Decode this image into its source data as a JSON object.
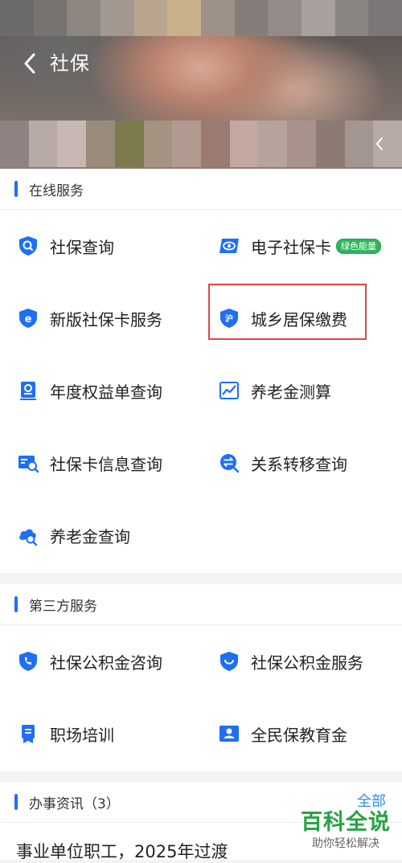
{
  "header": {
    "title": "社保"
  },
  "sections": {
    "online": {
      "title": "在线服务",
      "items": [
        {
          "label": "社保查询",
          "icon": "shield-search-icon"
        },
        {
          "label": "电子社保卡",
          "icon": "eye-card-icon",
          "badge": "绿色能量"
        },
        {
          "label": "新版社保卡服务",
          "icon": "shield-e-icon"
        },
        {
          "label": "城乡居保缴费",
          "icon": "shield-hu-icon"
        },
        {
          "label": "年度权益单查询",
          "icon": "receipt-search-icon"
        },
        {
          "label": "养老金测算",
          "icon": "line-chart-icon"
        },
        {
          "label": "社保卡信息查询",
          "icon": "card-search-icon"
        },
        {
          "label": "关系转移查询",
          "icon": "transfer-search-icon"
        },
        {
          "label": "养老金查询",
          "icon": "cloud-search-icon"
        }
      ]
    },
    "third": {
      "title": "第三方服务",
      "items": [
        {
          "label": "社保公积金咨询",
          "icon": "shield-phone-icon"
        },
        {
          "label": "社保公积金服务",
          "icon": "shield-smile-icon"
        },
        {
          "label": "职场培训",
          "icon": "ribbon-badge-icon"
        },
        {
          "label": "全民保教育金",
          "icon": "person-card-icon"
        }
      ]
    },
    "news": {
      "title": "办事资讯（3）",
      "more": "全部",
      "first_item": "事业单位职工，2025年过渡"
    }
  },
  "watermark": {
    "brand": "百科全说",
    "slogan": "助你轻松解决"
  },
  "colors": {
    "accent": "#1e6ff5",
    "badge": "#2fb55e",
    "highlight": "#e04747"
  }
}
